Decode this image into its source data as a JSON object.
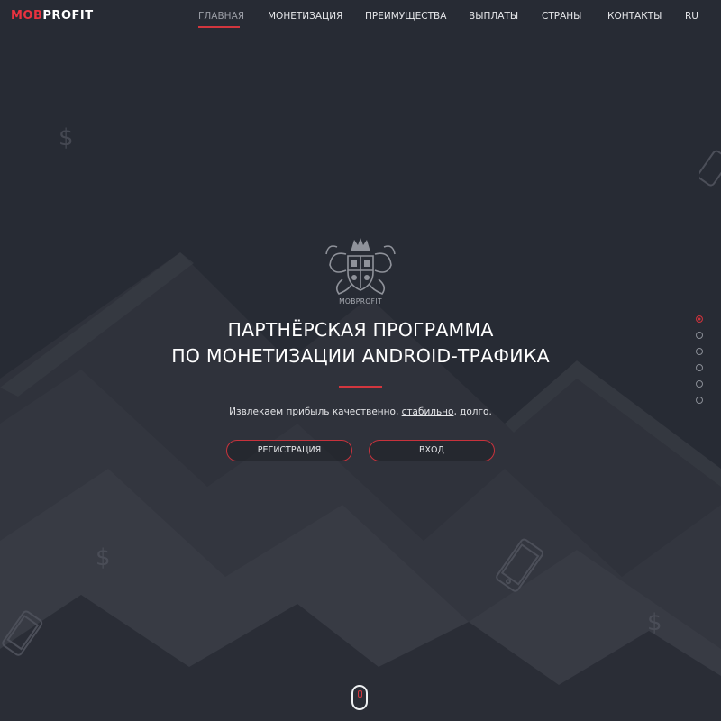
{
  "header": {
    "logo": {
      "part1": "MOB",
      "part2": "PROFIT"
    },
    "nav": [
      {
        "label": "ГЛАВНАЯ",
        "active": true
      },
      {
        "label": "МОНЕТИЗАЦИЯ",
        "active": false
      },
      {
        "label": "ПРЕИМУЩЕСТВА",
        "active": false
      },
      {
        "label": "ВЫПЛАТЫ",
        "active": false
      },
      {
        "label": "СТРАНЫ",
        "active": false
      },
      {
        "label": "КОНТАКТЫ",
        "active": false
      },
      {
        "label": "RU",
        "active": false
      }
    ]
  },
  "hero": {
    "emblem_text": "MOBPROFIT",
    "headline_line1": "ПАРТНЁРСКАЯ ПРОГРАММА",
    "headline_line2": "ПО МОНЕТИЗАЦИИ ANDROID-ТРАФИКА",
    "tagline_before": "Извлекаем прибыль качественно, ",
    "tagline_link": "стабильно",
    "tagline_after": ", долго.",
    "register_button": "РЕГИСТРАЦИЯ",
    "login_button": "ВХОД"
  },
  "pagination": {
    "count": 6,
    "active_index": 0
  },
  "decor": {
    "dollar_symbol": "$"
  },
  "colors": {
    "accent": "#d2363e",
    "background": "#272b34",
    "text": "#ffffff"
  }
}
